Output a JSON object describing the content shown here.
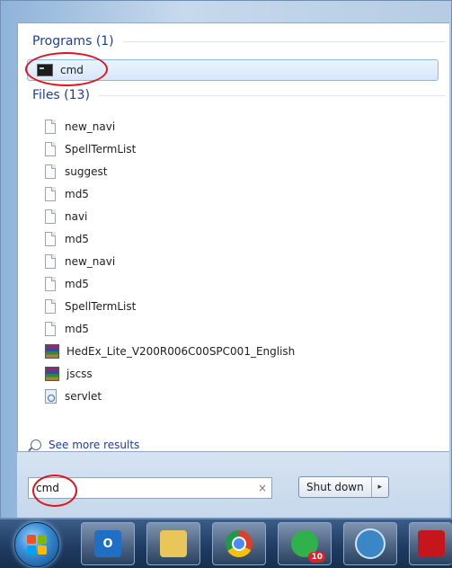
{
  "programs": {
    "header": "Programs (1)",
    "items": [
      {
        "label": "cmd",
        "icon": "cmd-icon"
      }
    ]
  },
  "files": {
    "header": "Files (13)",
    "items": [
      {
        "label": "new_navi",
        "icon": "document-icon"
      },
      {
        "label": "SpellTermList",
        "icon": "document-icon"
      },
      {
        "label": "suggest",
        "icon": "document-icon"
      },
      {
        "label": "md5",
        "icon": "document-icon"
      },
      {
        "label": "navi",
        "icon": "document-icon"
      },
      {
        "label": "md5",
        "icon": "document-icon"
      },
      {
        "label": "new_navi",
        "icon": "document-icon"
      },
      {
        "label": "md5",
        "icon": "document-icon"
      },
      {
        "label": "SpellTermList",
        "icon": "document-icon"
      },
      {
        "label": "md5",
        "icon": "document-icon"
      },
      {
        "label": "HedEx_Lite_V200R006C00SPC001_English",
        "icon": "archive-icon"
      },
      {
        "label": "jscss",
        "icon": "archive-icon"
      },
      {
        "label": "servlet",
        "icon": "settings-file-icon"
      }
    ]
  },
  "see_more": {
    "label": "See more results"
  },
  "search": {
    "value": "cmd",
    "clear_glyph": "×"
  },
  "shutdown": {
    "label": "Shut down",
    "arrow_glyph": "▸"
  },
  "taskbar": {
    "apps": [
      {
        "name": "outlook-icon",
        "glyph": "O",
        "color": "#1f6fc4"
      },
      {
        "name": "file-explorer-icon",
        "glyph": "",
        "color": "#e9c65a"
      },
      {
        "name": "chrome-icon",
        "glyph": "",
        "color": "#d9412e"
      },
      {
        "name": "whatsapp-icon",
        "glyph": "",
        "color": "#2fb14b",
        "badge": "10"
      },
      {
        "name": "network-app-icon",
        "glyph": "",
        "color": "#3b86c7"
      },
      {
        "name": "acrobat-icon",
        "glyph": "",
        "color": "#c4161c"
      }
    ]
  }
}
